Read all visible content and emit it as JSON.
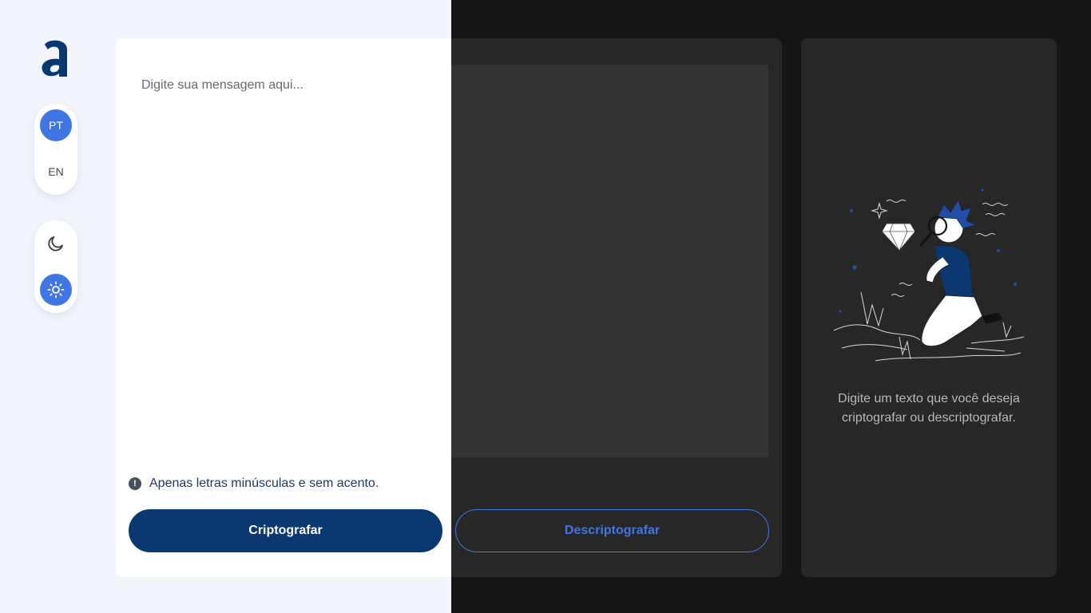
{
  "sidebar": {
    "logo_icon": "alura-logo-icon",
    "language": {
      "options": [
        {
          "label": "PT",
          "active": true
        },
        {
          "label": "EN",
          "active": false
        }
      ]
    },
    "theme": {
      "options": [
        {
          "icon": "moon-icon",
          "active": false
        },
        {
          "icon": "sun-icon",
          "active": true
        }
      ]
    }
  },
  "editor": {
    "placeholder": "Digite sua mensagem aqui...",
    "value": "",
    "hint": "Apenas letras minúsculas e sem acento.",
    "hint_icon": "exclamation-circle-icon",
    "encrypt_label": "Criptografar",
    "decrypt_label": "Descriptografar"
  },
  "output": {
    "illustration": "person-with-magnifier-and-diamond-illustration",
    "message": "Digite um texto que você deseja criptografar ou descriptografar."
  },
  "colors": {
    "primary_dark": "#0a3871",
    "accent": "#3f76e4",
    "light_bg": "#f2f5fc",
    "dark_bg": "#151515",
    "dark_card": "#272727"
  }
}
